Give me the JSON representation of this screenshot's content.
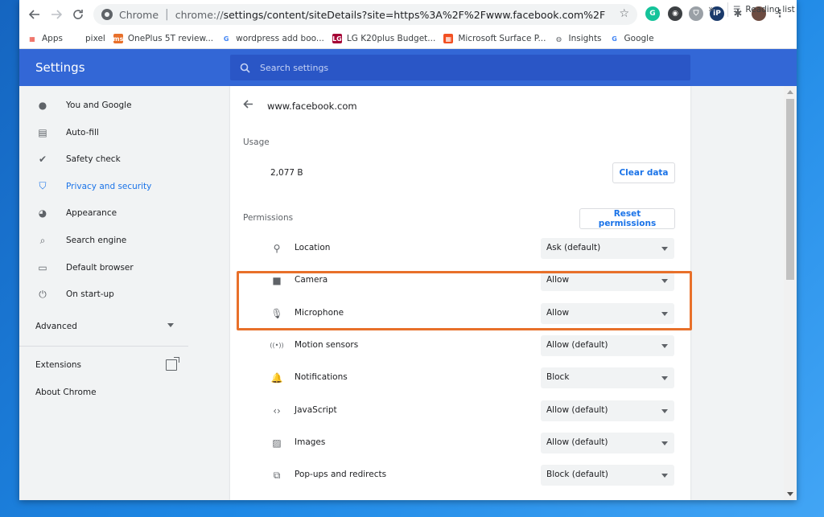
{
  "browser": {
    "omnibox_brand": "Chrome",
    "omnibox_url_host": "chrome://",
    "omnibox_url_path": "settings/content/siteDetails?site=https%3A%2F%2Fwww.facebook.com%2F"
  },
  "bookmarks": [
    {
      "label": "Apps",
      "icon": "apps-grid-icon",
      "color": "#ea4335"
    },
    {
      "label": "pixel",
      "icon": "apple-icon",
      "color": "#5f6368"
    },
    {
      "label": "OnePlus 5T review...",
      "icon": "site-icon",
      "color": "#e8702a"
    },
    {
      "label": "wordpress add boo...",
      "icon": "google-icon",
      "color": "#4285f4"
    },
    {
      "label": "LG K20plus Budget...",
      "icon": "lg-icon",
      "color": "#a50034"
    },
    {
      "label": "Microsoft Surface P...",
      "icon": "microsoft-icon",
      "color": "#f25022"
    },
    {
      "label": "Insights",
      "icon": "globe-icon",
      "color": "#5f6368"
    },
    {
      "label": "Google",
      "icon": "google-icon",
      "color": "#4285f4"
    }
  ],
  "bookmarks_more": "»",
  "reading_list": "Reading list",
  "settings": {
    "title": "Settings",
    "search_placeholder": "Search settings"
  },
  "sidebar": {
    "items": [
      {
        "label": "You and Google",
        "icon": "person-icon"
      },
      {
        "label": "Auto-fill",
        "icon": "clipboard-icon"
      },
      {
        "label": "Safety check",
        "icon": "shield-check-icon"
      },
      {
        "label": "Privacy and security",
        "icon": "shield-icon",
        "active": true
      },
      {
        "label": "Appearance",
        "icon": "palette-icon"
      },
      {
        "label": "Search engine",
        "icon": "search-icon"
      },
      {
        "label": "Default browser",
        "icon": "browser-icon"
      },
      {
        "label": "On start-up",
        "icon": "power-icon"
      }
    ],
    "advanced": "Advanced",
    "extensions": "Extensions",
    "about": "About Chrome"
  },
  "site": {
    "title": "www.facebook.com",
    "usage_heading": "Usage",
    "usage_value": "2,077 B",
    "clear_data": "Clear data",
    "permissions_heading": "Permissions",
    "reset_permissions": "Reset permissions",
    "permissions": [
      {
        "label": "Location",
        "value": "Ask (default)",
        "icon": "location-pin-icon"
      },
      {
        "label": "Camera",
        "value": "Allow",
        "icon": "camera-icon"
      },
      {
        "label": "Microphone",
        "value": "Allow",
        "icon": "microphone-icon"
      },
      {
        "label": "Motion sensors",
        "value": "Allow (default)",
        "icon": "motion-sensor-icon"
      },
      {
        "label": "Notifications",
        "value": "Block",
        "icon": "bell-icon"
      },
      {
        "label": "JavaScript",
        "value": "Allow (default)",
        "icon": "code-icon"
      },
      {
        "label": "Images",
        "value": "Allow (default)",
        "icon": "image-icon"
      },
      {
        "label": "Pop-ups and redirects",
        "value": "Block (default)",
        "icon": "popup-icon"
      }
    ]
  },
  "colors": {
    "header": "#3367d6",
    "accent": "#1a73e8",
    "highlight": "#e8702a"
  }
}
